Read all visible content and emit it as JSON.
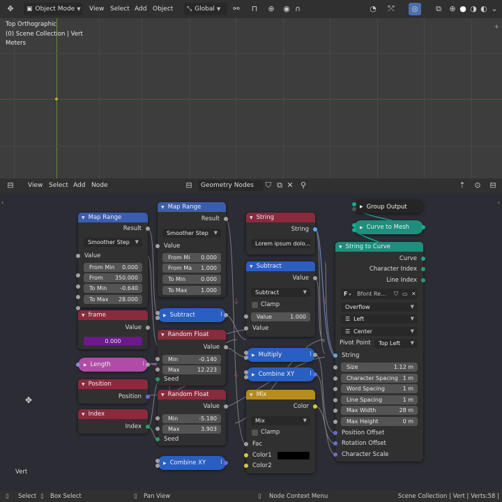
{
  "viewport_header": {
    "mode": "Object Mode",
    "menus": [
      "View",
      "Select",
      "Add",
      "Object"
    ],
    "orientation": "Global"
  },
  "viewport": {
    "view_name": "Top Orthographic",
    "collection": "(0) Scene Collection | Vert",
    "units": "Meters"
  },
  "node_header": {
    "menus": [
      "View",
      "Select",
      "Add",
      "Node"
    ],
    "tree_name": "Geometry Nodes"
  },
  "nodes": {
    "map_range_1": {
      "title": "Map Range",
      "result": "Result",
      "interp": "Smoother Step",
      "value": "Value",
      "fields": [
        {
          "k": "From Min",
          "v": "0.000"
        },
        {
          "k": "From",
          "v": "350.000"
        },
        {
          "k": "To Min",
          "v": "-0.640"
        },
        {
          "k": "To Max",
          "v": "28.000"
        }
      ]
    },
    "map_range_2": {
      "title": "Map Range",
      "result": "Result",
      "interp": "Smoother Step",
      "value": "Value",
      "fields": [
        {
          "k": "From Mi",
          "v": "0.000"
        },
        {
          "k": "From Ma",
          "v": "1.000"
        },
        {
          "k": "To Min",
          "v": "0.000"
        },
        {
          "k": "To Max",
          "v": "1.000"
        }
      ]
    },
    "frame": {
      "title": "frame",
      "value": "Value",
      "field": "0.000"
    },
    "length": {
      "title": "Length"
    },
    "position": {
      "title": "Position",
      "out": "Position"
    },
    "index": {
      "title": "Index",
      "out": "Index"
    },
    "subtract_pill": {
      "title": "Subtract"
    },
    "random_float_1": {
      "title": "Random Float",
      "value": "Value",
      "min_k": "Min",
      "min_v": "-0.140",
      "max_k": "Max",
      "max_v": "12.223",
      "seed": "Seed"
    },
    "random_float_2": {
      "title": "Random Float",
      "value": "Value",
      "min_k": "Min",
      "min_v": "-5.180",
      "max_k": "Max",
      "max_v": "3.903",
      "seed": "Seed"
    },
    "combine_xy_bottom": {
      "title": "Combine XY"
    },
    "string": {
      "title": "String",
      "out": "String",
      "text": "Lorem ipsum dolo..."
    },
    "subtract": {
      "title": "Subtract",
      "value_out": "Value",
      "op": "Subtract",
      "clamp": "Clamp",
      "field_k": "Value",
      "field_v": "1.000",
      "value_in": "Value"
    },
    "multiply": {
      "title": "Multiply"
    },
    "combine_xy": {
      "title": "Combine XY"
    },
    "mix": {
      "title": "Mix",
      "color": "Color",
      "mode": "Mix",
      "clamp": "Clamp",
      "fac": "Fac",
      "color1": "Color1",
      "color2": "Color2"
    },
    "group_output": {
      "title": "Group Output"
    },
    "curve_to_mesh": {
      "title": "Curve to Mesh"
    },
    "string_to_curve": {
      "title": "String to Curve",
      "curve": "Curve",
      "char_index": "Character Index",
      "line_index": "Line Index",
      "font": "Bfont Re...",
      "overflow": "Overflow",
      "align_x": "Left",
      "align_y": "Center",
      "pivot_label": "Pivot Point",
      "pivot_value": "Top Left",
      "string_in": "String",
      "fields": [
        {
          "k": "Size",
          "v": "1.12 m"
        },
        {
          "k": "Character Spacing",
          "v": "1 m"
        },
        {
          "k": "Word Spacing",
          "v": "1 m"
        },
        {
          "k": "Line Spacing",
          "v": "1 m"
        },
        {
          "k": "Max Width",
          "v": "28 m"
        },
        {
          "k": "Max Height",
          "v": "0 m"
        }
      ],
      "pos_offset": "Position Offset",
      "rot_offset": "Rotation Offset",
      "char_scale": "Character Scale"
    }
  },
  "bottom_label": "Vert",
  "status": {
    "select": "Select",
    "box_select": "Box Select",
    "pan_view": "Pan View",
    "context_menu": "Node Context Menu",
    "right": "Scene Collection | Vert | Verts:58 |"
  },
  "colors": {
    "converter": "#3b5db0",
    "input": "#8a2a3d",
    "function": "#2a5fc2",
    "geometry": "#1d8f7c",
    "mix": "#b88b1f",
    "length": "#b04ca8"
  }
}
